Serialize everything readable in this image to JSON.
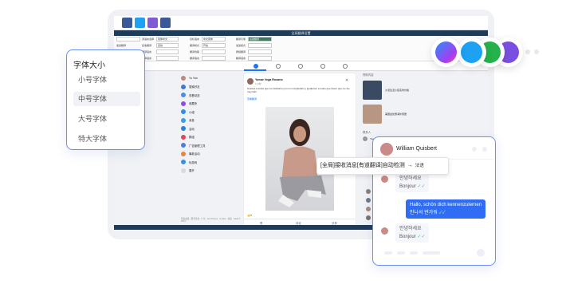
{
  "app": {
    "window_title": "全局翻译设置",
    "config_rows": [
      [
        "",
        "源语言选择",
        "简体中文",
        "目标语言",
        "中文简体",
        "翻译引擎",
        "谷歌翻译"
      ],
      [
        "发送翻译",
        "接收翻译",
        "自动",
        "翻译模式",
        "开启",
        "发送模式",
        ""
      ],
      [
        "自动翻译",
        "翻译语言",
        "",
        "翻译线路",
        "",
        "群组翻译",
        ""
      ],
      [
        "自动翻译",
        "翻译语言",
        "",
        "翻译语言",
        "",
        "翻译语言",
        ""
      ]
    ]
  },
  "facebook": {
    "profile_name": "Yu Yan",
    "left_nav": [
      "Yu Yan",
      "搜索好友",
      "查看动态",
      "收藏夹",
      "小组",
      "消息",
      "活动",
      "群组",
      "广告管理工具",
      "筹款活动",
      "玩游戏",
      "展开"
    ],
    "post": {
      "author": "Yomar Vega Rosario",
      "time": "1小时",
      "text": "Gracias a todos que me felicitaron por mi cumpleaños y igualamer a todos que hacer que me fue muy feliz",
      "link": "查看翻译",
      "actions": [
        "赞",
        "评论",
        "分享"
      ]
    },
    "right": {
      "section": "赞助内容",
      "ads": [
        "沙漠生活小区实时价格",
        "美国最优惠海外家居"
      ],
      "contacts_title": "联系人",
      "contact": "Yao Wei"
    },
    "footer": "隐私政策 · 服务条款 · 广告 · Ad Choices · Cookie · 更多 · Meta © 2024"
  },
  "font_menu": {
    "title": "字体大小",
    "options": [
      "小号字体",
      "中号字体",
      "大号字体",
      "特大字体"
    ],
    "selected": "中号字体"
  },
  "translate_popup": {
    "text": "[全局]接收消息[有道翻译]自动检测",
    "arrow": "→",
    "action": "法语"
  },
  "chat": {
    "contact_name": "William Quisbert",
    "messages": [
      {
        "dir": "in",
        "lines": [
          "안녕하세요",
          "Bonjour"
        ]
      },
      {
        "dir": "out",
        "lines": [
          "Hallo, schön dich kennenzulernen",
          "만나서 반가워"
        ]
      },
      {
        "dir": "in",
        "lines": [
          "안녕하세요",
          "Bonjour"
        ]
      }
    ],
    "check": "✓✓"
  },
  "social_icons": [
    "messenger-icon",
    "twitter-icon",
    "whatsapp-icon",
    "viber-icon"
  ]
}
